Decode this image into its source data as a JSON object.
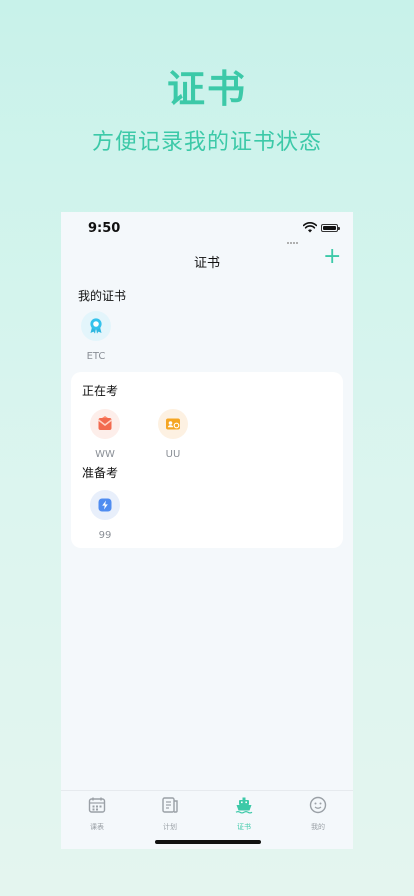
{
  "hero": {
    "title": "证书",
    "subtitle": "方便记录我的证书状态"
  },
  "status_bar": {
    "time": "9:50"
  },
  "nav": {
    "title": "证书",
    "add_label": "+"
  },
  "my_certificates": {
    "title": "我的证书",
    "items": [
      {
        "label": "ETC",
        "icon": "award-ribbon-icon"
      }
    ]
  },
  "in_exam": {
    "title": "正在考",
    "items": [
      {
        "label": "WW",
        "icon": "red-envelope-icon"
      },
      {
        "label": "UU",
        "icon": "id-card-icon"
      }
    ]
  },
  "preparing": {
    "title": "准备考",
    "items": [
      {
        "label": "99",
        "icon": "lightning-icon"
      }
    ]
  },
  "tabs": [
    {
      "label": "课表",
      "icon": "calendar-icon",
      "active": false
    },
    {
      "label": "计划",
      "icon": "plan-book-icon",
      "active": false
    },
    {
      "label": "证书",
      "icon": "ship-icon",
      "active": true
    },
    {
      "label": "我的",
      "icon": "smile-face-icon",
      "active": false
    }
  ],
  "colors": {
    "accent": "#3cc9a8",
    "background_top": "#c8f2ea",
    "card": "#ffffff",
    "muted_text": "#8a8f96"
  }
}
